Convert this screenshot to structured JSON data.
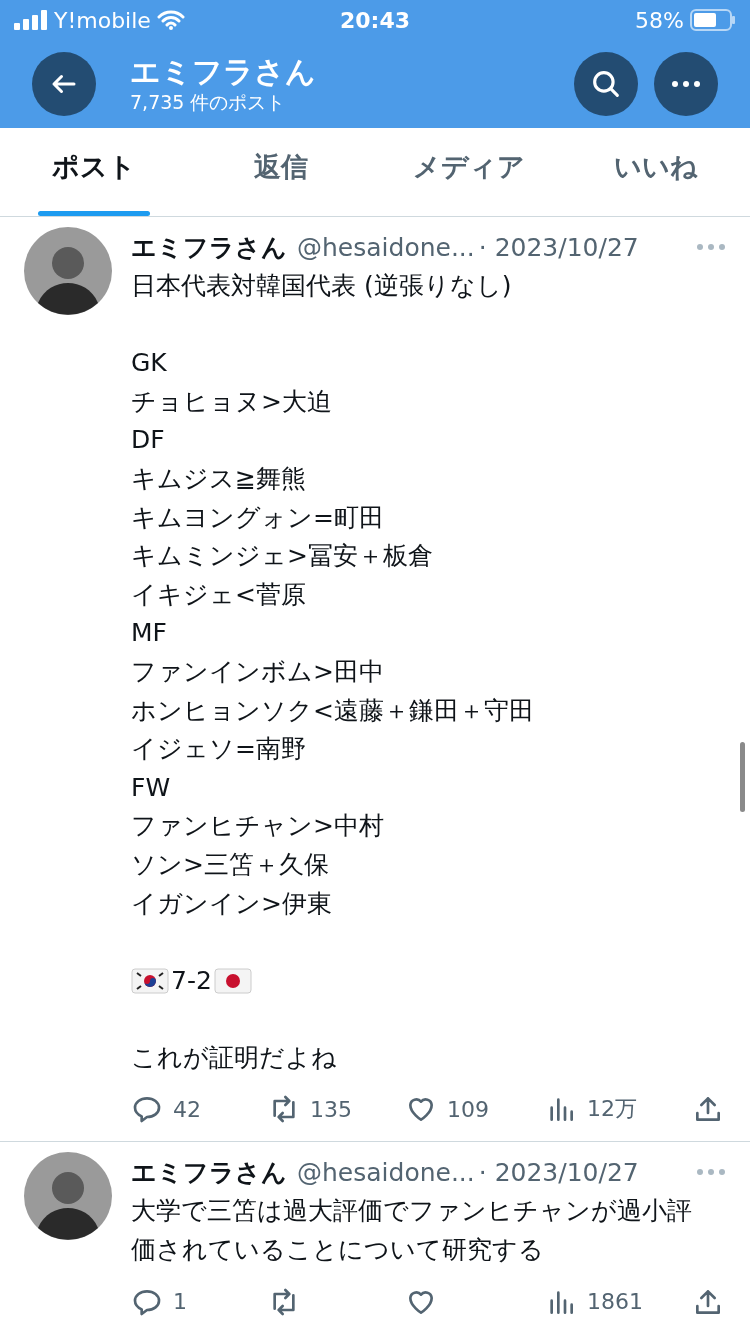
{
  "status_bar": {
    "carrier": "Y!mobile",
    "time": "20:43",
    "battery": "58%"
  },
  "header": {
    "title": "エミフラさん",
    "subtitle": "7,735 件のポスト"
  },
  "tabs": [
    {
      "label": "ポスト",
      "selected": true
    },
    {
      "label": "返信",
      "selected": false
    },
    {
      "label": "メディア",
      "selected": false
    },
    {
      "label": "いいね",
      "selected": false
    }
  ],
  "posts": [
    {
      "name": "エミフラさん",
      "handle": "@hesaidone...",
      "date": "· 2023/10/27",
      "paragraphs": [
        {
          "kind": "text",
          "text": "日本代表対韓国代表 (逆張りなし)"
        },
        {
          "kind": "lines",
          "lines": [
            "GK",
            "チョヒョヌ>大迫",
            "DF",
            "キムジス≧舞熊",
            "キムヨングォン=町田",
            "キムミンジェ>冨安＋板倉",
            "イキジェ<菅原",
            "MF",
            "ファンインボム>田中",
            "ホンヒョンソク<遠藤＋鎌田＋守田",
            "イジェソ=南野",
            "FW",
            "ファンヒチャン>中村",
            "ソン>三笘＋久保",
            "イガンイン>伊東"
          ]
        },
        {
          "kind": "score",
          "text": "7-2"
        },
        {
          "kind": "text",
          "text": "これが証明だよね"
        }
      ],
      "actions": {
        "replies": "42",
        "reposts": "135",
        "likes": "109",
        "views": "12万"
      }
    },
    {
      "name": "エミフラさん",
      "handle": "@hesaidone...",
      "date": "· 2023/10/27",
      "paragraphs": [
        {
          "kind": "text",
          "text": "大学で三笘は過大評価でファンヒチャンが過小評価されていることについて研究する"
        }
      ],
      "actions": {
        "replies": "1",
        "views": "1861"
      }
    }
  ]
}
